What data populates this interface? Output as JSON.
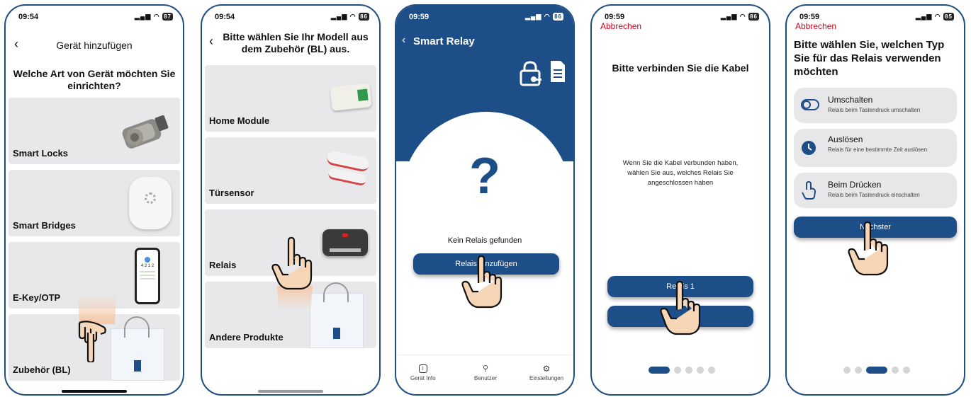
{
  "colors": {
    "brand_blue": "#1d4e87",
    "cancel_red": "#d0021b",
    "card_gray": "#e8e8ea"
  },
  "screen1": {
    "time": "09:54",
    "battery": "87",
    "title": "Gerät hinzufügen",
    "question": "Welche Art von Gerät möchten Sie einrichten?",
    "cards": [
      "Smart Locks",
      "Smart Bridges",
      "E-Key/OTP",
      "Zubehör (BL)"
    ],
    "phone_mock": {
      "digits": "4 2 1 2"
    }
  },
  "screen2": {
    "time": "09:54",
    "battery": "86",
    "title": "Bitte wählen Sie Ihr Modell aus dem Zubehör (BL) aus.",
    "cards": [
      "Home Module",
      "Türsensor",
      "Relais",
      "Andere Produkte"
    ]
  },
  "screen3": {
    "time": "09:59",
    "battery": "86",
    "title": "Smart Relay",
    "question_mark": "?",
    "empty_text": "Kein Relais gefunden",
    "add_button": "Relais hinzufügen",
    "tabs": [
      {
        "icon": "info-icon",
        "label": "Gerät Info"
      },
      {
        "icon": "user-icon",
        "label": "Benutzer"
      },
      {
        "icon": "settings-icon",
        "label": "Einstellungen"
      }
    ]
  },
  "screen4": {
    "time": "09:59",
    "battery": "86",
    "cancel": "Abbrechen",
    "heading": "Bitte verbinden Sie die Kabel",
    "body": "Wenn Sie die Kabel verbunden haben, wählen Sie aus, welches Relais Sie angeschlossen haben",
    "button1": "Relais 1",
    "button2": "",
    "page_dots": 5,
    "active_dot": 0
  },
  "screen5": {
    "time": "09:59",
    "battery": "85",
    "cancel": "Abbrechen",
    "heading": "Bitte wählen Sie, welchen Typ Sie für das Relais verwenden möchten",
    "options": [
      {
        "icon": "toggle-icon",
        "title": "Umschalten",
        "subtitle": "Relais beim Tastendruck umschalten"
      },
      {
        "icon": "clock-icon",
        "title": "Auslösen",
        "subtitle": "Relais für eine bestimmte Zeit auslösen"
      },
      {
        "icon": "touch-icon",
        "title": "Beim Drücken",
        "subtitle": "Relais beim Tastendruck einschalten"
      }
    ],
    "next_button": "Nächster",
    "page_dots": 5,
    "active_dot": 2
  }
}
